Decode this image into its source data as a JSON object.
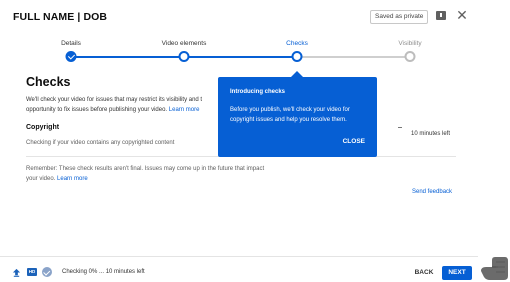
{
  "header": {
    "title": "FULL NAME | DOB",
    "saved_badge": "Saved as private",
    "feedback_icon": "feedback-flag-icon",
    "close_icon": "close-icon",
    "close_glyph": "✕"
  },
  "stepper": {
    "steps": [
      {
        "label": "Details",
        "state": "done"
      },
      {
        "label": "Video elements",
        "state": "done"
      },
      {
        "label": "Checks",
        "state": "current"
      },
      {
        "label": "Visibility",
        "state": "future"
      }
    ]
  },
  "content": {
    "title": "Checks",
    "desc_line1": "We'll check your video for issues that may restrict its visibility and t",
    "desc_line2": "opportunity to fix issues before publishing your video.",
    "desc_link": "Learn more",
    "copyright_heading": "Copyright",
    "copyright_status": "Checking if your video contains any copyrighted content",
    "time_left": "10 minutes left",
    "remember_text": "Remember: These check results aren't final. Issues may come up in the future that impact your video.",
    "remember_link": "Learn more",
    "send_feedback": "Send feedback"
  },
  "tooltip": {
    "title": "Introducing checks",
    "body": "Before you publish, we'll check your video for copyright issues and help you resolve them.",
    "close_label": "CLOSE"
  },
  "footer": {
    "status": "Checking 0% ... 10 minutes left",
    "hd_badge": "HD",
    "back_label": "BACK",
    "next_label": "NEXT"
  },
  "colors": {
    "accent": "#065fd4",
    "tooltip_bg": "#065fd4"
  }
}
